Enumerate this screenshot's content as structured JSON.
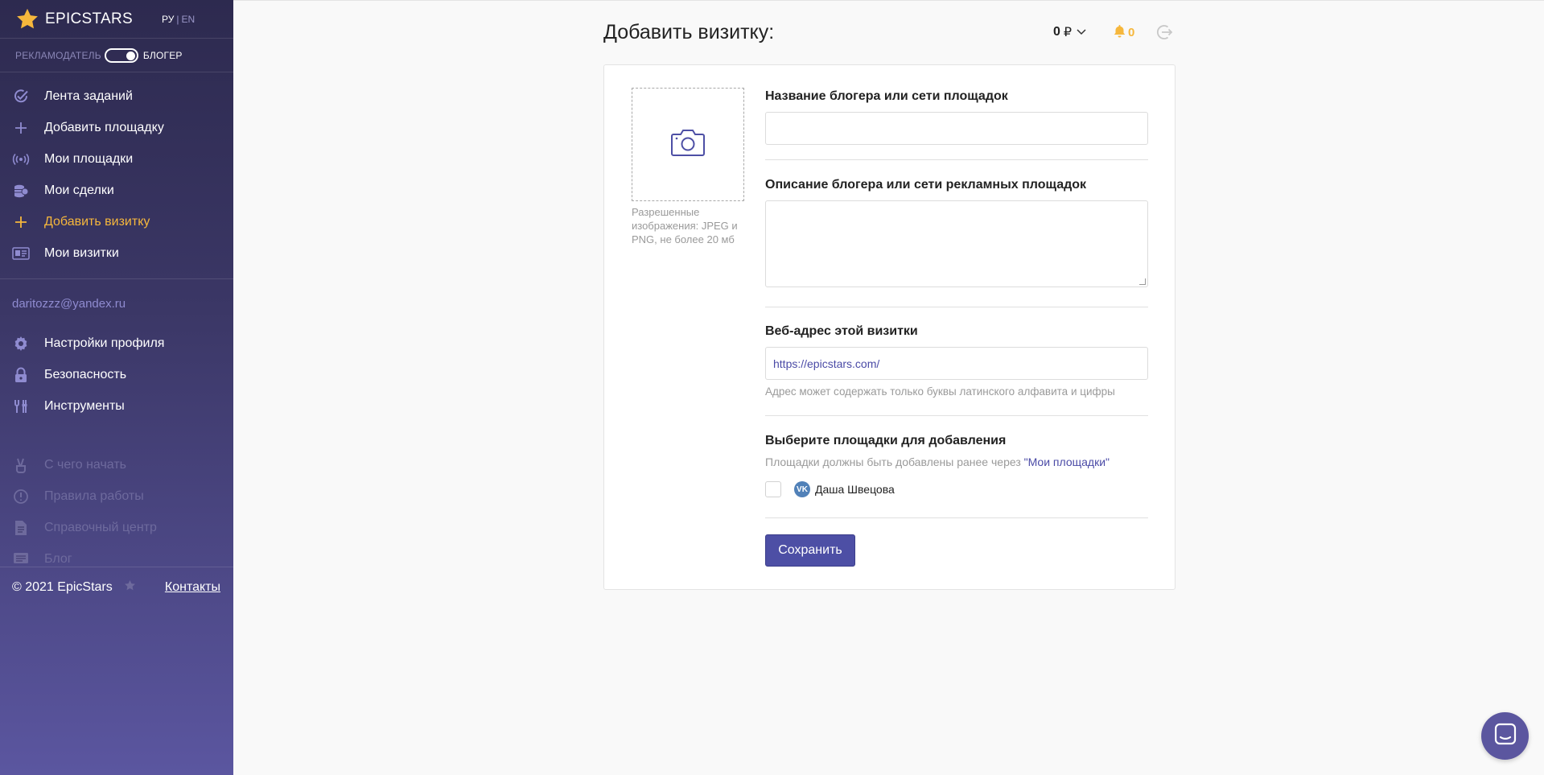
{
  "brand": {
    "name": "EPICSTARS",
    "accent": "#f6b73c",
    "primary": "#4d4fa5"
  },
  "lang": {
    "ru": "РУ",
    "separator": "|",
    "en": "EN"
  },
  "role": {
    "advertiser": "РЕКЛАМОДАТЕЛЬ",
    "blogger": "БЛОГЕР",
    "selected": "blogger"
  },
  "nav_main": [
    {
      "label": "Лента заданий",
      "icon": "check-circle-icon"
    },
    {
      "label": "Добавить площадку",
      "icon": "plus-icon"
    },
    {
      "label": "Мои площадки",
      "icon": "broadcast-icon"
    },
    {
      "label": "Мои сделки",
      "icon": "coins-icon"
    },
    {
      "label": "Добавить визитку",
      "icon": "plus-icon",
      "active": true
    },
    {
      "label": "Мои визитки",
      "icon": "id-card-icon"
    }
  ],
  "user": {
    "email": "daritozzz@yandex.ru"
  },
  "nav_profile": [
    {
      "label": "Настройки профиля",
      "icon": "gear-icon"
    },
    {
      "label": "Безопасность",
      "icon": "lock-icon"
    },
    {
      "label": "Инструменты",
      "icon": "tools-icon"
    }
  ],
  "nav_help": [
    {
      "label": "С чего начать",
      "icon": "victory-hand-icon"
    },
    {
      "label": "Правила работы",
      "icon": "info-icon"
    },
    {
      "label": "Справочный центр",
      "icon": "document-icon"
    },
    {
      "label": "Блог",
      "icon": "blog-icon"
    }
  ],
  "footer": {
    "copyright": "© 2021 EpicStars",
    "contacts": "Контакты"
  },
  "header": {
    "title": "Добавить визитку:",
    "balance": "0",
    "currency": "₽",
    "notifications": "0"
  },
  "form": {
    "photo_hint": "Разрешенные изображения: JPEG и PNG, не более 20 мб",
    "name_label": "Название блогера или сети площадок",
    "name_value": "",
    "description_label": "Описание блогера или сети рекламных площадок",
    "description_value": "",
    "url_label": "Веб-адрес этой визитки",
    "url_value": "https://epicstars.com/",
    "url_hint": "Адрес может содержать только буквы латинского алфавита и цифры",
    "platforms_label": "Выберите площадки для добавления",
    "platforms_hint_prefix": "Площадки должны быть добавлены ранее через ",
    "platforms_hint_link": "\"Мои площадки\"",
    "platforms": [
      {
        "name": "Даша Швецова",
        "network": "vk",
        "checked": false
      }
    ],
    "save_label": "Сохранить"
  }
}
